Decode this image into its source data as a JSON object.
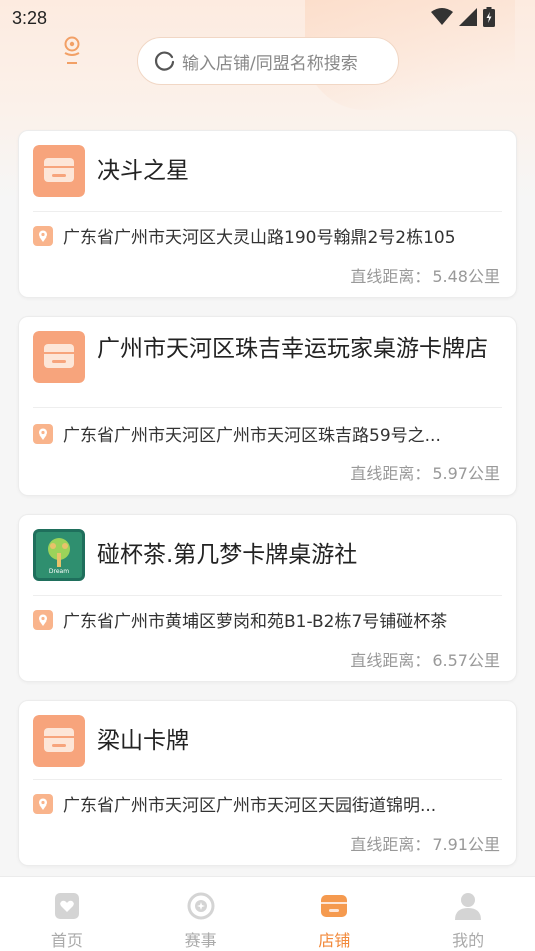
{
  "status_bar": {
    "time": "3:28",
    "icons": [
      "wifi-icon",
      "signal-icon",
      "battery-icon"
    ]
  },
  "header": {
    "location_icon": "location-pin-icon",
    "search": {
      "placeholder": "输入店铺/同盟名称搜索",
      "icon": "search-icon"
    }
  },
  "stores": [
    {
      "name": "决斗之星",
      "thumb": "store-icon",
      "address": "广东省广州市天河区大灵山路190号翰鼎2号2栋105",
      "distance_label": "直线距离：",
      "distance": "5.48公里"
    },
    {
      "name": "广州市天河区珠吉幸运玩家桌游卡牌店",
      "thumb": "store-icon",
      "address": "广东省广州市天河区广州市天河区珠吉路59号之...",
      "distance_label": "直线距离：",
      "distance": "5.97公里"
    },
    {
      "name": "碰杯茶.第几梦卡牌桌游社",
      "thumb": "store-photo",
      "thumb_text": "Dream",
      "address": "广东省广州市黄埔区萝岗和苑B1-B2栋7号铺碰杯茶",
      "distance_label": "直线距离：",
      "distance": "6.57公里"
    },
    {
      "name": "梁山卡牌",
      "thumb": "store-icon",
      "address": "广东省广州市天河区广州市天河区天园街道锦明...",
      "distance_label": "直线距离：",
      "distance": "7.91公里"
    }
  ],
  "tabbar": {
    "items": [
      {
        "label": "首页",
        "icon": "home-icon",
        "active": false
      },
      {
        "label": "赛事",
        "icon": "tournament-icon",
        "active": false
      },
      {
        "label": "店铺",
        "icon": "store-icon",
        "active": true
      },
      {
        "label": "我的",
        "icon": "profile-icon",
        "active": false
      }
    ]
  },
  "colors": {
    "accent": "#f28a3c",
    "inactive": "#aaaaaa",
    "store_icon_bg": "#f7a47c"
  }
}
